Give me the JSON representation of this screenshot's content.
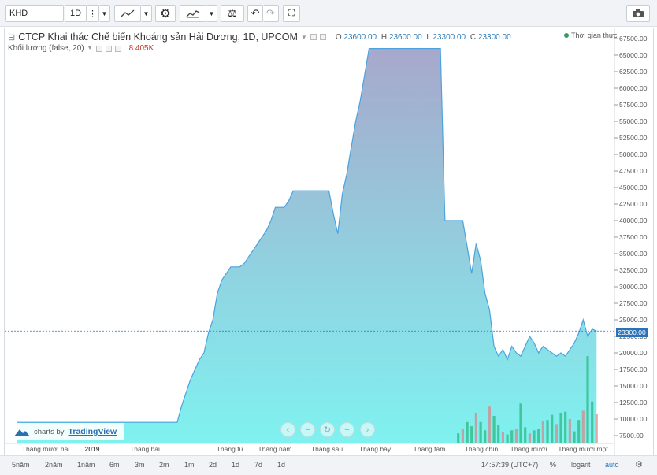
{
  "toolbar": {
    "symbol": "KHD",
    "interval": "1D"
  },
  "legend": {
    "title": "CTCP Khai thác Chế biến Khoáng sản Hải Dương, 1D, UPCOM",
    "open_label": "O",
    "open": "23600.00",
    "high_label": "H",
    "high": "23600.00",
    "low_label": "L",
    "low": "23300.00",
    "close_label": "C",
    "close": "23300.00",
    "volume_label": "Khối lượng (false, 20)",
    "volume_value": "8.405K",
    "realtime": "Thời gian thực"
  },
  "badge": {
    "prefix": "charts by",
    "brand": "TradingView"
  },
  "bottombar": {
    "ranges": [
      "5năm",
      "2năm",
      "1năm",
      "6m",
      "3m",
      "2m",
      "1m",
      "2d",
      "1d",
      "7d",
      "1d"
    ],
    "time": "14:57:39 (UTC+7)",
    "percent": "%",
    "log": "logarit",
    "auto": "auto"
  },
  "chart_data": {
    "type": "area",
    "y_ticks": [
      "67500.00",
      "65000.00",
      "62500.00",
      "60000.00",
      "57500.00",
      "55000.00",
      "52500.00",
      "50000.00",
      "47500.00",
      "45000.00",
      "42500.00",
      "40000.00",
      "37500.00",
      "35000.00",
      "32500.00",
      "30000.00",
      "27500.00",
      "25000.00",
      "22500.00",
      "20000.00",
      "17500.00",
      "15000.00",
      "12500.00",
      "10000.00",
      "7500.00"
    ],
    "x_ticks": [
      "Tháng mười hai",
      "2019",
      "Tháng hai",
      "Tháng tư",
      "Tháng năm",
      "Tháng sáu",
      "Tháng bảy",
      "Tháng tám",
      "Tháng chín",
      "Tháng mười",
      "Tháng mười một"
    ],
    "ylim": [
      6000,
      69000
    ],
    "last_price": 23300,
    "last_price_label": "23300.00",
    "price": [
      [
        0,
        9500
      ],
      [
        36,
        9500
      ],
      [
        37,
        12000
      ],
      [
        38,
        14000
      ],
      [
        39,
        16000
      ],
      [
        40,
        17500
      ],
      [
        41,
        19000
      ],
      [
        42,
        20000
      ],
      [
        43,
        23000
      ],
      [
        44,
        25000
      ],
      [
        45,
        29000
      ],
      [
        46,
        31000
      ],
      [
        47,
        32000
      ],
      [
        48,
        33000
      ],
      [
        50,
        33000
      ],
      [
        51,
        33500
      ],
      [
        52,
        34500
      ],
      [
        53,
        35500
      ],
      [
        54,
        36500
      ],
      [
        55,
        37500
      ],
      [
        56,
        38500
      ],
      [
        57,
        40000
      ],
      [
        58,
        42000
      ],
      [
        60,
        42000
      ],
      [
        61,
        43000
      ],
      [
        62,
        44500
      ],
      [
        70,
        44500
      ],
      [
        71,
        41000
      ],
      [
        72,
        38000
      ],
      [
        73,
        44000
      ],
      [
        74,
        47000
      ],
      [
        75,
        51000
      ],
      [
        76,
        55000
      ],
      [
        77,
        58000
      ],
      [
        78,
        62000
      ],
      [
        79,
        66000
      ],
      [
        95,
        66000
      ],
      [
        96,
        40000
      ],
      [
        100,
        40000
      ],
      [
        101,
        36000
      ],
      [
        102,
        32000
      ],
      [
        103,
        36500
      ],
      [
        104,
        34000
      ],
      [
        105,
        29000
      ],
      [
        106,
        26500
      ],
      [
        107,
        21000
      ],
      [
        108,
        19500
      ],
      [
        109,
        20500
      ],
      [
        110,
        19000
      ],
      [
        111,
        21000
      ],
      [
        112,
        20000
      ],
      [
        113,
        19500
      ],
      [
        114,
        21000
      ],
      [
        115,
        22500
      ],
      [
        116,
        21500
      ],
      [
        117,
        20000
      ],
      [
        118,
        21000
      ],
      [
        119,
        20500
      ],
      [
        120,
        20000
      ],
      [
        121,
        19500
      ],
      [
        122,
        20000
      ],
      [
        123,
        19500
      ],
      [
        124,
        20500
      ],
      [
        125,
        21500
      ],
      [
        126,
        23000
      ],
      [
        127,
        25000
      ],
      [
        128,
        22500
      ],
      [
        129,
        23600
      ],
      [
        130,
        23300
      ]
    ],
    "volume": [
      [
        99,
        900
      ],
      [
        100,
        1300
      ],
      [
        101,
        2000
      ],
      [
        102,
        1600
      ],
      [
        103,
        2900
      ],
      [
        104,
        2000
      ],
      [
        105,
        1200
      ],
      [
        106,
        3500
      ],
      [
        107,
        2600
      ],
      [
        108,
        1700
      ],
      [
        109,
        1000
      ],
      [
        110,
        800
      ],
      [
        111,
        1200
      ],
      [
        112,
        1300
      ],
      [
        113,
        3800
      ],
      [
        114,
        1500
      ],
      [
        115,
        900
      ],
      [
        116,
        1200
      ],
      [
        117,
        1300
      ],
      [
        118,
        2100
      ],
      [
        119,
        2200
      ],
      [
        120,
        2700
      ],
      [
        121,
        1800
      ],
      [
        122,
        2900
      ],
      [
        123,
        3000
      ],
      [
        124,
        2300
      ],
      [
        125,
        1100
      ],
      [
        126,
        2200
      ],
      [
        127,
        3100
      ],
      [
        128,
        8400
      ],
      [
        129,
        4000
      ],
      [
        130,
        2800
      ]
    ],
    "volume_max": 8405,
    "colors": {
      "line": "#4aa3df",
      "area_top": "#a7a8cc",
      "area_bottom": "#7ff2f0",
      "volume_up": "#35c08f",
      "volume_down": "#e57373",
      "price_tag": "#2a73b7"
    }
  }
}
